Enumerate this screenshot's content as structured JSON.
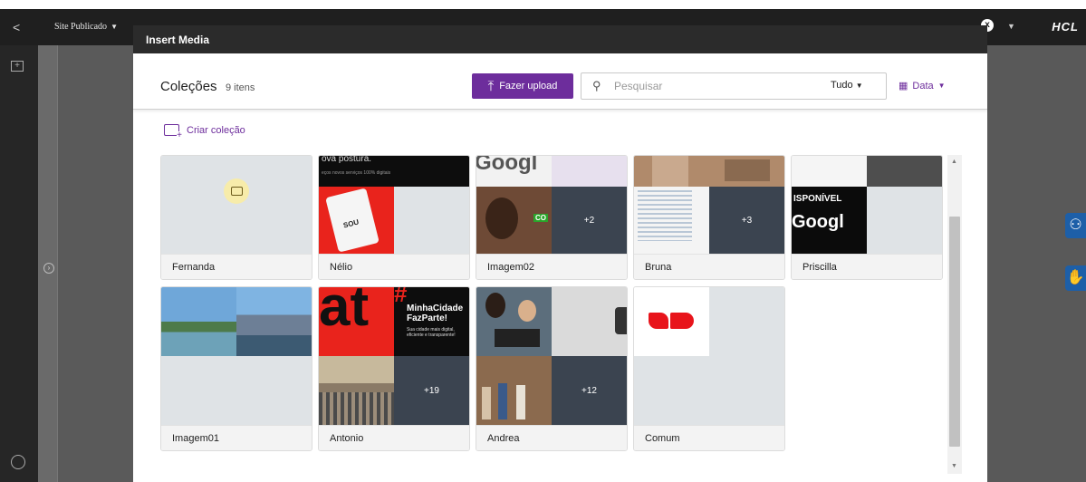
{
  "app": {
    "site_label": "Site Publicado",
    "brand": "HCL",
    "back_glyph": "<",
    "close_glyph": "x"
  },
  "modal": {
    "title": "Insert Media",
    "collections_title": "Coleções",
    "items_count": "9 itens",
    "upload_label": "Fazer upload",
    "search": {
      "placeholder": "Pesquisar",
      "value": ""
    },
    "filter_value": "Tudo",
    "sort_label": "Data",
    "create_collection_label": "Criar coleção"
  },
  "collections": [
    {
      "name": "Fernanda",
      "overflow": ""
    },
    {
      "name": "Nélio",
      "overflow": ""
    },
    {
      "name": "Imagem02",
      "overflow": "+2"
    },
    {
      "name": "Bruna",
      "overflow": "+3"
    },
    {
      "name": "Priscilla",
      "overflow": ""
    },
    {
      "name": "Imagem01",
      "overflow": ""
    },
    {
      "name": "Antonio",
      "overflow": "+19"
    },
    {
      "name": "Andrea",
      "overflow": "+12"
    },
    {
      "name": "Comum",
      "overflow": ""
    }
  ],
  "thumb_text": {
    "nelio_banner": "ova postura.",
    "nelio_sub": "eços novos serviços 100% digitais",
    "nelio_card": "SOU",
    "google_word": "Googl",
    "minha_cidade": "MinhaCidade FazParte!",
    "minha_cidade_sub": "Sua cidade mais digital, eficiente e transparente!",
    "disponivel": "ISPONÍVEL",
    "co": "CO",
    "at": "at",
    "hash": "#"
  },
  "colors": {
    "accent": "#6d2d9c",
    "header_bg": "#2b2b2b",
    "folder_badge": "#f7ecaa",
    "comum_logo": "#e8141b"
  }
}
